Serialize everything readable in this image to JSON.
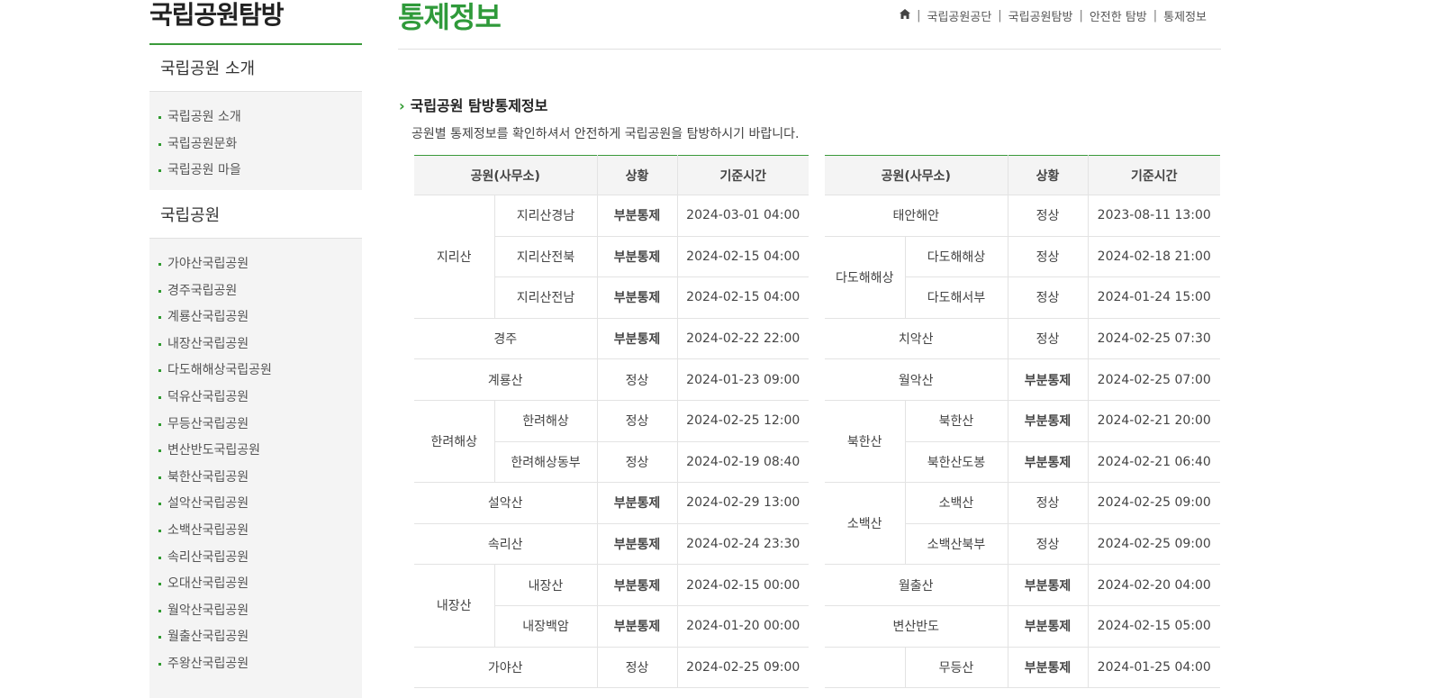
{
  "sidebar": {
    "title": "국립공원탐방",
    "sections": [
      {
        "heading": "국립공원 소개",
        "items": [
          "국립공원 소개",
          "국립공원문화",
          "국립공원 마을"
        ]
      },
      {
        "heading": "국립공원",
        "items": [
          "가야산국립공원",
          "경주국립공원",
          "계룡산국립공원",
          "내장산국립공원",
          "다도해해상국립공원",
          "덕유산국립공원",
          "무등산국립공원",
          "변산반도국립공원",
          "북한산국립공원",
          "설악산국립공원",
          "소백산국립공원",
          "속리산국립공원",
          "오대산국립공원",
          "월악산국립공원",
          "월출산국립공원",
          "주왕산국립공원"
        ]
      }
    ]
  },
  "header": {
    "page_title": "통제정보",
    "breadcrumb": [
      "국립공원공단",
      "국립공원탐방",
      "안전한 탐방",
      "통제정보"
    ]
  },
  "section": {
    "title": "국립공원 탐방통제정보",
    "description": "공원별 통제정보를 확인하셔서 안전하게 국립공원을 탐방하시기 바랍니다."
  },
  "table": {
    "headers": [
      "공원(사무소)",
      "상황",
      "기준시간"
    ],
    "status_colors": {
      "부분통제": "#c8761a",
      "정상": "#444444"
    },
    "left": [
      {
        "park": "지리산",
        "offices": [
          {
            "name": "지리산경남",
            "status": "부분통제",
            "time": "2024-03-01 04:00"
          },
          {
            "name": "지리산전북",
            "status": "부분통제",
            "time": "2024-02-15 04:00"
          },
          {
            "name": "지리산전남",
            "status": "부분통제",
            "time": "2024-02-15 04:00"
          }
        ]
      },
      {
        "park": "경주",
        "status": "부분통제",
        "time": "2024-02-22 22:00"
      },
      {
        "park": "계룡산",
        "status": "정상",
        "time": "2024-01-23 09:00"
      },
      {
        "park": "한려해상",
        "offices": [
          {
            "name": "한려해상",
            "status": "정상",
            "time": "2024-02-25 12:00"
          },
          {
            "name": "한려해상동부",
            "status": "정상",
            "time": "2024-02-19 08:40"
          }
        ]
      },
      {
        "park": "설악산",
        "status": "부분통제",
        "time": "2024-02-29 13:00"
      },
      {
        "park": "속리산",
        "status": "부분통제",
        "time": "2024-02-24 23:30"
      },
      {
        "park": "내장산",
        "offices": [
          {
            "name": "내장산",
            "status": "부분통제",
            "time": "2024-02-15 00:00"
          },
          {
            "name": "내장백암",
            "status": "부분통제",
            "time": "2024-01-20 00:00"
          }
        ]
      },
      {
        "park": "가야산",
        "status": "정상",
        "time": "2024-02-25 09:00"
      }
    ],
    "right": [
      {
        "park": "태안해안",
        "status": "정상",
        "time": "2023-08-11 13:00"
      },
      {
        "park": "다도해해상",
        "offices": [
          {
            "name": "다도해해상",
            "status": "정상",
            "time": "2024-02-18 21:00"
          },
          {
            "name": "다도해서부",
            "status": "정상",
            "time": "2024-01-24 15:00"
          }
        ]
      },
      {
        "park": "치악산",
        "status": "정상",
        "time": "2024-02-25 07:30"
      },
      {
        "park": "월악산",
        "status": "부분통제",
        "time": "2024-02-25 07:00"
      },
      {
        "park": "북한산",
        "offices": [
          {
            "name": "북한산",
            "status": "부분통제",
            "time": "2024-02-21 20:00"
          },
          {
            "name": "북한산도봉",
            "status": "부분통제",
            "time": "2024-02-21 06:40"
          }
        ]
      },
      {
        "park": "소백산",
        "offices": [
          {
            "name": "소백산",
            "status": "정상",
            "time": "2024-02-25 09:00"
          },
          {
            "name": "소백산북부",
            "status": "정상",
            "time": "2024-02-25 09:00"
          }
        ]
      },
      {
        "park": "월출산",
        "status": "부분통제",
        "time": "2024-02-20 04:00"
      },
      {
        "park": "변산반도",
        "status": "부분통제",
        "time": "2024-02-15 05:00"
      },
      {
        "park": "",
        "offices": [
          {
            "name": "무등산",
            "status": "부분통제",
            "time": "2024-01-25 04:00"
          }
        ]
      }
    ]
  }
}
